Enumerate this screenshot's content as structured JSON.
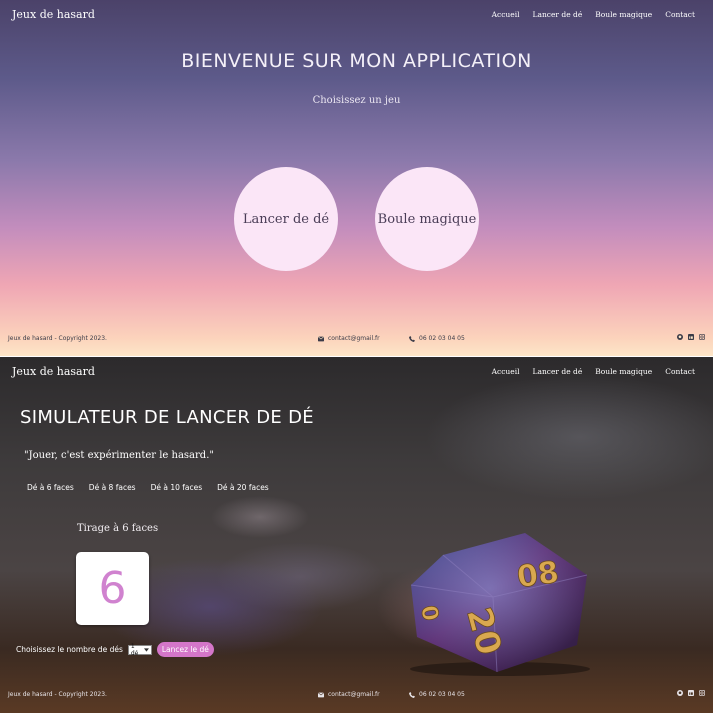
{
  "home": {
    "brand": "Jeux de hasard",
    "nav": [
      "Accueil",
      "Lancer de dé",
      "Boule magique",
      "Contact"
    ],
    "title": "BIENVENUE SUR MON APPLICATION",
    "subtitle": "Choisissez un jeu",
    "games": [
      "Lancer de dé",
      "Boule magique"
    ],
    "footer": {
      "copyright": "Jeux de hasard - Copyright 2023.",
      "email": "contact@gmail.fr",
      "phone": "06 02 03 04 05",
      "social_icons": [
        "github-icon",
        "linkedin-icon",
        "instagram-icon"
      ]
    }
  },
  "simulator": {
    "brand": "Jeux de hasard",
    "nav": [
      "Accueil",
      "Lancer de dé",
      "Boule magique",
      "Contact"
    ],
    "title": "SIMULATEUR DE LANCER DE DÉ",
    "quote": "\"Jouer, c'est expérimenter le hasard.\"",
    "dice_tabs": [
      "Dé à 6 faces",
      "Dé à 8 faces",
      "Dé à 10 faces",
      "Dé à 20 faces"
    ],
    "draw_label": "Tirage à 6 faces",
    "result": "6",
    "controls_label": "Choisissez le nombre de dés",
    "select_value": "1 dé",
    "roll_button": "Lancez le dé",
    "footer": {
      "copyright": "Jeux de hasard - Copyright 2023.",
      "email": "contact@gmail.fr",
      "phone": "06 02 03 04 05",
      "social_icons": [
        "github-icon",
        "linkedin-icon",
        "instagram-icon"
      ]
    }
  },
  "colors": {
    "accent": "#d476c9",
    "result_digit": "#d082cf",
    "circle_bg": "#fbe6f7"
  }
}
